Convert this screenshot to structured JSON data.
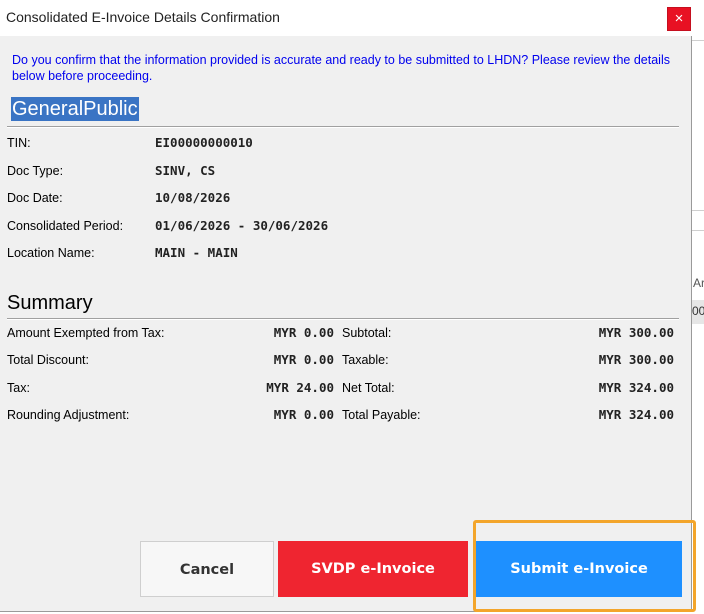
{
  "window": {
    "title": "Consolidated E-Invoice Details Confirmation",
    "close_glyph": "×"
  },
  "notice": "Do you confirm that the information provided is accurate and ready to be submitted to LHDN? Please review the details below before proceeding.",
  "customer_name": "GeneralPublic",
  "details": {
    "tin": {
      "label": "TIN:",
      "value": "EI00000000010"
    },
    "doc_type": {
      "label": "Doc Type:",
      "value": "SINV, CS"
    },
    "doc_date": {
      "label": "Doc Date:",
      "value": "10/08/2026"
    },
    "period": {
      "label": "Consolidated Period:",
      "value": "01/06/2026 - 30/06/2026"
    },
    "location": {
      "label": "Location Name:",
      "value": "MAIN - MAIN"
    }
  },
  "summary": {
    "title": "Summary",
    "left": [
      {
        "label": "Amount Exempted from Tax:",
        "value": "MYR 0.00"
      },
      {
        "label": "Total Discount:",
        "value": "MYR 0.00"
      },
      {
        "label": "Tax:",
        "value": "MYR 24.00"
      },
      {
        "label": "Rounding Adjustment:",
        "value": "MYR 0.00"
      }
    ],
    "right": [
      {
        "label": "Subtotal:",
        "value": "MYR 300.00"
      },
      {
        "label": "Taxable:",
        "value": "MYR 300.00"
      },
      {
        "label": "Net Total:",
        "value": "MYR 324.00"
      },
      {
        "label": "Total Payable:",
        "value": "MYR 324.00"
      }
    ]
  },
  "buttons": {
    "cancel": "Cancel",
    "svdp": "SVDP e-Invoice",
    "submit": "Submit e-Invoice"
  },
  "background_app": {
    "partial_text_1": "Ar",
    "partial_text_2": "00"
  },
  "colors": {
    "notice_text": "#0000ee",
    "selection_highlight": "#3a74c4",
    "close_button": "#e81123",
    "svdp_button": "#ef2530",
    "submit_button": "#1e90ff",
    "callout_border": "#f3a52b"
  }
}
